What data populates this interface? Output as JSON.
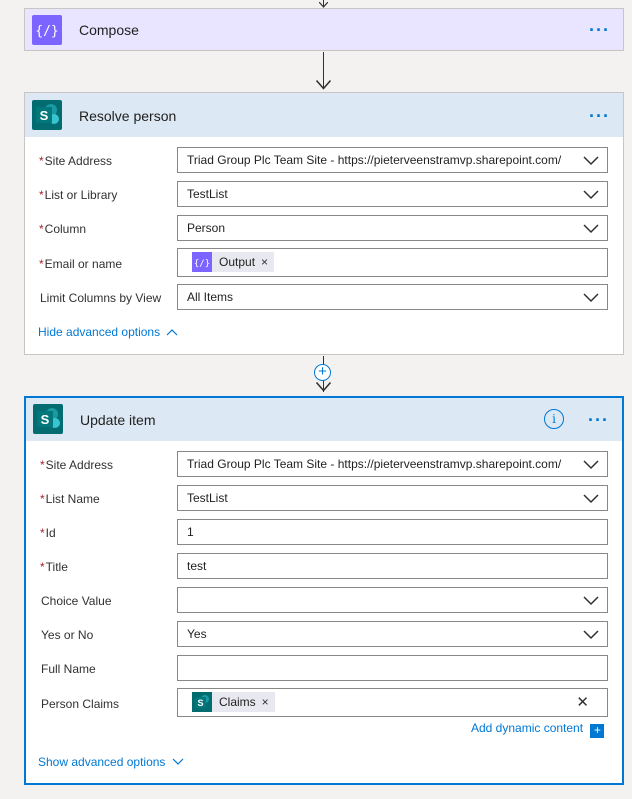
{
  "compose": {
    "title": "Compose",
    "menu": "···"
  },
  "resolve": {
    "title": "Resolve person",
    "menu": "···",
    "fields": [
      {
        "label": "Site Address",
        "required": "*",
        "value": "Triad Group Plc Team Site - https://pieterveenstramvp.sharepoint.com/"
      },
      {
        "label": "List or Library",
        "required": "*",
        "value": "TestList"
      },
      {
        "label": "Column",
        "required": "*",
        "value": "Person"
      },
      {
        "label": "Email or name",
        "required": "*",
        "token": "Output",
        "token_remove": "×"
      },
      {
        "label": "Limit Columns by View",
        "required": "",
        "value": "All Items"
      }
    ],
    "advanced_link": "Hide advanced options"
  },
  "update": {
    "title": "Update item",
    "menu": "···",
    "info": "i",
    "fields": [
      {
        "label": "Site Address",
        "required": "*",
        "value": "Triad Group Plc Team Site - https://pieterveenstramvp.sharepoint.com/"
      },
      {
        "label": "List Name",
        "required": "*",
        "value": "TestList"
      },
      {
        "label": "Id",
        "required": "*",
        "value": "1"
      },
      {
        "label": "Title",
        "required": "*",
        "value": "test"
      },
      {
        "label": "Choice Value",
        "required": "",
        "value": ""
      },
      {
        "label": "Yes or No",
        "required": "",
        "value": "Yes"
      },
      {
        "label": "Full Name",
        "required": "",
        "value": ""
      },
      {
        "label": "Person Claims",
        "required": "",
        "token": "Claims",
        "token_remove": "×",
        "clear": "✕"
      }
    ],
    "dynamic_content": "Add dynamic content",
    "dynamic_plus": "+",
    "advanced_link": "Show advanced options"
  },
  "add_step": "+",
  "colors": {
    "accent": "#0078d4",
    "compose": "#7b64ff",
    "sharepoint": "#036c70"
  }
}
